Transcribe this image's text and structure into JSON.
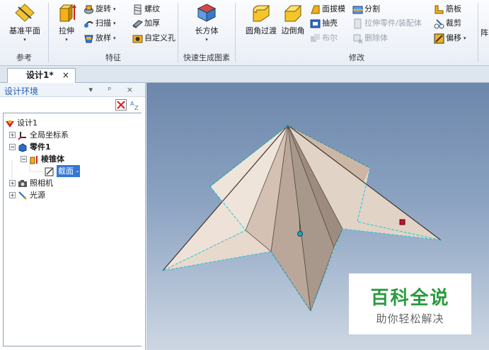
{
  "ribbon": {
    "groups": {
      "reference": "参考",
      "feature": "特征",
      "quick": "快速生成图素",
      "modify": "修改"
    },
    "datum_plane": "基准平面",
    "extrude": "拉伸",
    "revolve": "旋转",
    "sweep": "扫描",
    "loft": "放样",
    "thread": "螺纹",
    "thicken": "加厚",
    "custom_hole": "自定义孔",
    "box": "长方体",
    "fillet": "圆角过渡",
    "chamfer": "边倒角",
    "draft": "面拔模",
    "shell": "抽壳",
    "boolean": "布尔",
    "split": "分割",
    "extrude_assembly": "拉伸零件/装配体",
    "delete_body": "删除体",
    "rib": "筋板",
    "trim": "裁剪",
    "offset": "偏移",
    "array_partial": "阵"
  },
  "doc_tab": {
    "label": "设计1*",
    "close": "×"
  },
  "panel": {
    "title": "设计环境",
    "controls": "▾ ᵖ ×",
    "tree": [
      {
        "label": "设计1"
      },
      {
        "label": "全局坐标系"
      },
      {
        "label": "零件1"
      },
      {
        "label": "棱锥体"
      },
      {
        "label": "截面 -"
      },
      {
        "label": "照相机"
      },
      {
        "label": "光源"
      }
    ]
  },
  "watermark": {
    "title": "百科全说",
    "subtitle": "助你轻松解决"
  }
}
